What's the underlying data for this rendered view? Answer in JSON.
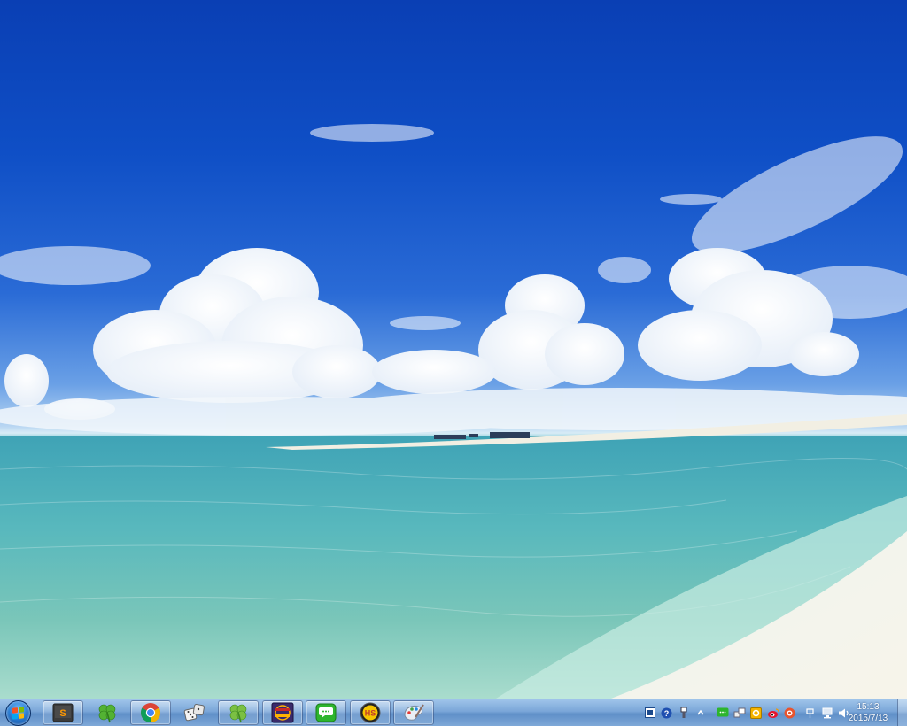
{
  "desktop": {
    "wallpaper": "beach-sea-sky"
  },
  "taskbar": {
    "start_icon": "windows-logo-icon",
    "pinned": [
      {
        "icon": "sublime-text-icon"
      },
      {
        "icon": "clover-icon"
      },
      {
        "icon": "chrome-icon"
      },
      {
        "icon": "dice-icon"
      },
      {
        "icon": "clover-icon"
      },
      {
        "icon": "java-ee-ide-icon"
      },
      {
        "icon": "chat-bubble-icon"
      },
      {
        "icon": "hs-badge-icon"
      },
      {
        "icon": "paint-palette-icon"
      }
    ],
    "tray": [
      {
        "icon": "input-method-icon"
      },
      {
        "icon": "help-icon"
      },
      {
        "icon": "usb-device-icon"
      },
      {
        "icon": "chevron-up-icon"
      },
      {
        "icon": "wechat-icon"
      },
      {
        "icon": "network-share-icon"
      },
      {
        "icon": "outlook-icon"
      },
      {
        "icon": "weibo-icon"
      },
      {
        "icon": "sogou-icon"
      },
      {
        "icon": "ime-cn-icon"
      },
      {
        "icon": "network-icon"
      },
      {
        "icon": "volume-icon"
      }
    ],
    "clock": {
      "time": "15:13",
      "date": "2015/7/13"
    },
    "colors": {
      "bar": "#7aa6d8",
      "chrome_red": "#db4437",
      "chrome_green": "#0f9d58",
      "chrome_yellow": "#f4b400",
      "chrome_blue": "#4285f4"
    }
  }
}
